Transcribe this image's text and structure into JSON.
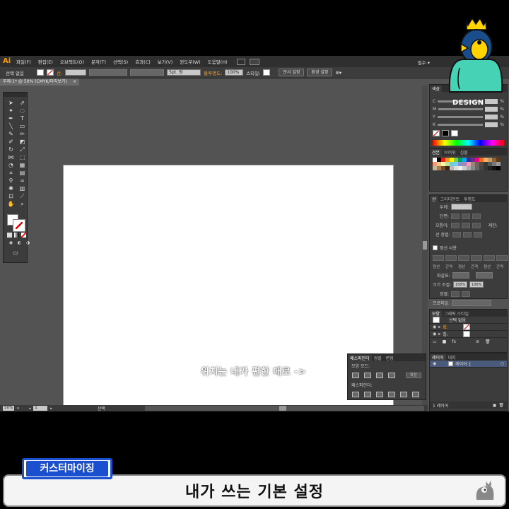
{
  "app": {
    "logo": "Ai",
    "menu": [
      "파일(F)",
      "편집(E)",
      "오브젝트(O)",
      "문자(T)",
      "선택(S)",
      "효과(C)",
      "보기(V)",
      "윈도우(W)",
      "도움말(H)"
    ],
    "workspace": "필수 ▾"
  },
  "control_bar": {
    "selection": "선택 없음",
    "stroke_label": "선:",
    "brush": "5pt. 원",
    "opacity_label": "불투명도:",
    "opacity_value": "100%",
    "style_label": "스타일:",
    "doc_setup": "문서 설정",
    "preferences": "환경 설정"
  },
  "document": {
    "tab_title": "무제-1* @ 50% (CMYK/미리보기)",
    "close": "×"
  },
  "status": {
    "zoom": "50%",
    "page": "1",
    "tool": "선택"
  },
  "panels": {
    "color": {
      "tab": "색상",
      "channels": [
        "C",
        "M",
        "Y",
        "K"
      ],
      "percent": "%"
    },
    "swatches": {
      "tabs": [
        "견본",
        "브러쉬",
        "심볼"
      ]
    },
    "stroke": {
      "tabs": [
        "선",
        "그라디언트",
        "투명도"
      ],
      "weight_label": "두께:",
      "cap_label": "단면:",
      "corner_label": "모퉁이:",
      "limit_label": "제한:",
      "align_label": "선 정렬:"
    },
    "dashed": {
      "label": "점선 사용",
      "cols": [
        "점선",
        "간격",
        "점선",
        "간격",
        "점선",
        "간격"
      ],
      "arrow_label": "화살표:",
      "scale_label": "크기 조절:",
      "scale_a": "100%",
      "scale_b": "100%",
      "align_label": "정렬:",
      "profile_label": "프로파일:"
    },
    "appearance": {
      "tabs": [
        "모양",
        "그래픽 스타일"
      ],
      "none": "선택 없음",
      "stroke": "획:",
      "fill": "칠:"
    },
    "layers": {
      "tabs": [
        "레이어",
        "대지"
      ],
      "layer_name": "레이어 1",
      "footer": "1 레이어"
    },
    "pathfinder": {
      "tabs": [
        "패스파인더",
        "정렬",
        "변형"
      ],
      "shape_modes": "모양 모드:",
      "expand": "확장",
      "pathfinders": "패스파인더:"
    }
  },
  "overlay": {
    "annotation": "위치는 내가 편한 대로 ->",
    "mascot_text": "DESIGN"
  },
  "banner": {
    "tag": "커스터마이징",
    "title": "내가 쓰는 기본 설정"
  },
  "colors": {
    "accent_orange": "#ff9a00",
    "tag_blue": "#1a4fd0",
    "ui_dark": "#3c3c3c",
    "canvas_gray": "#535353"
  }
}
